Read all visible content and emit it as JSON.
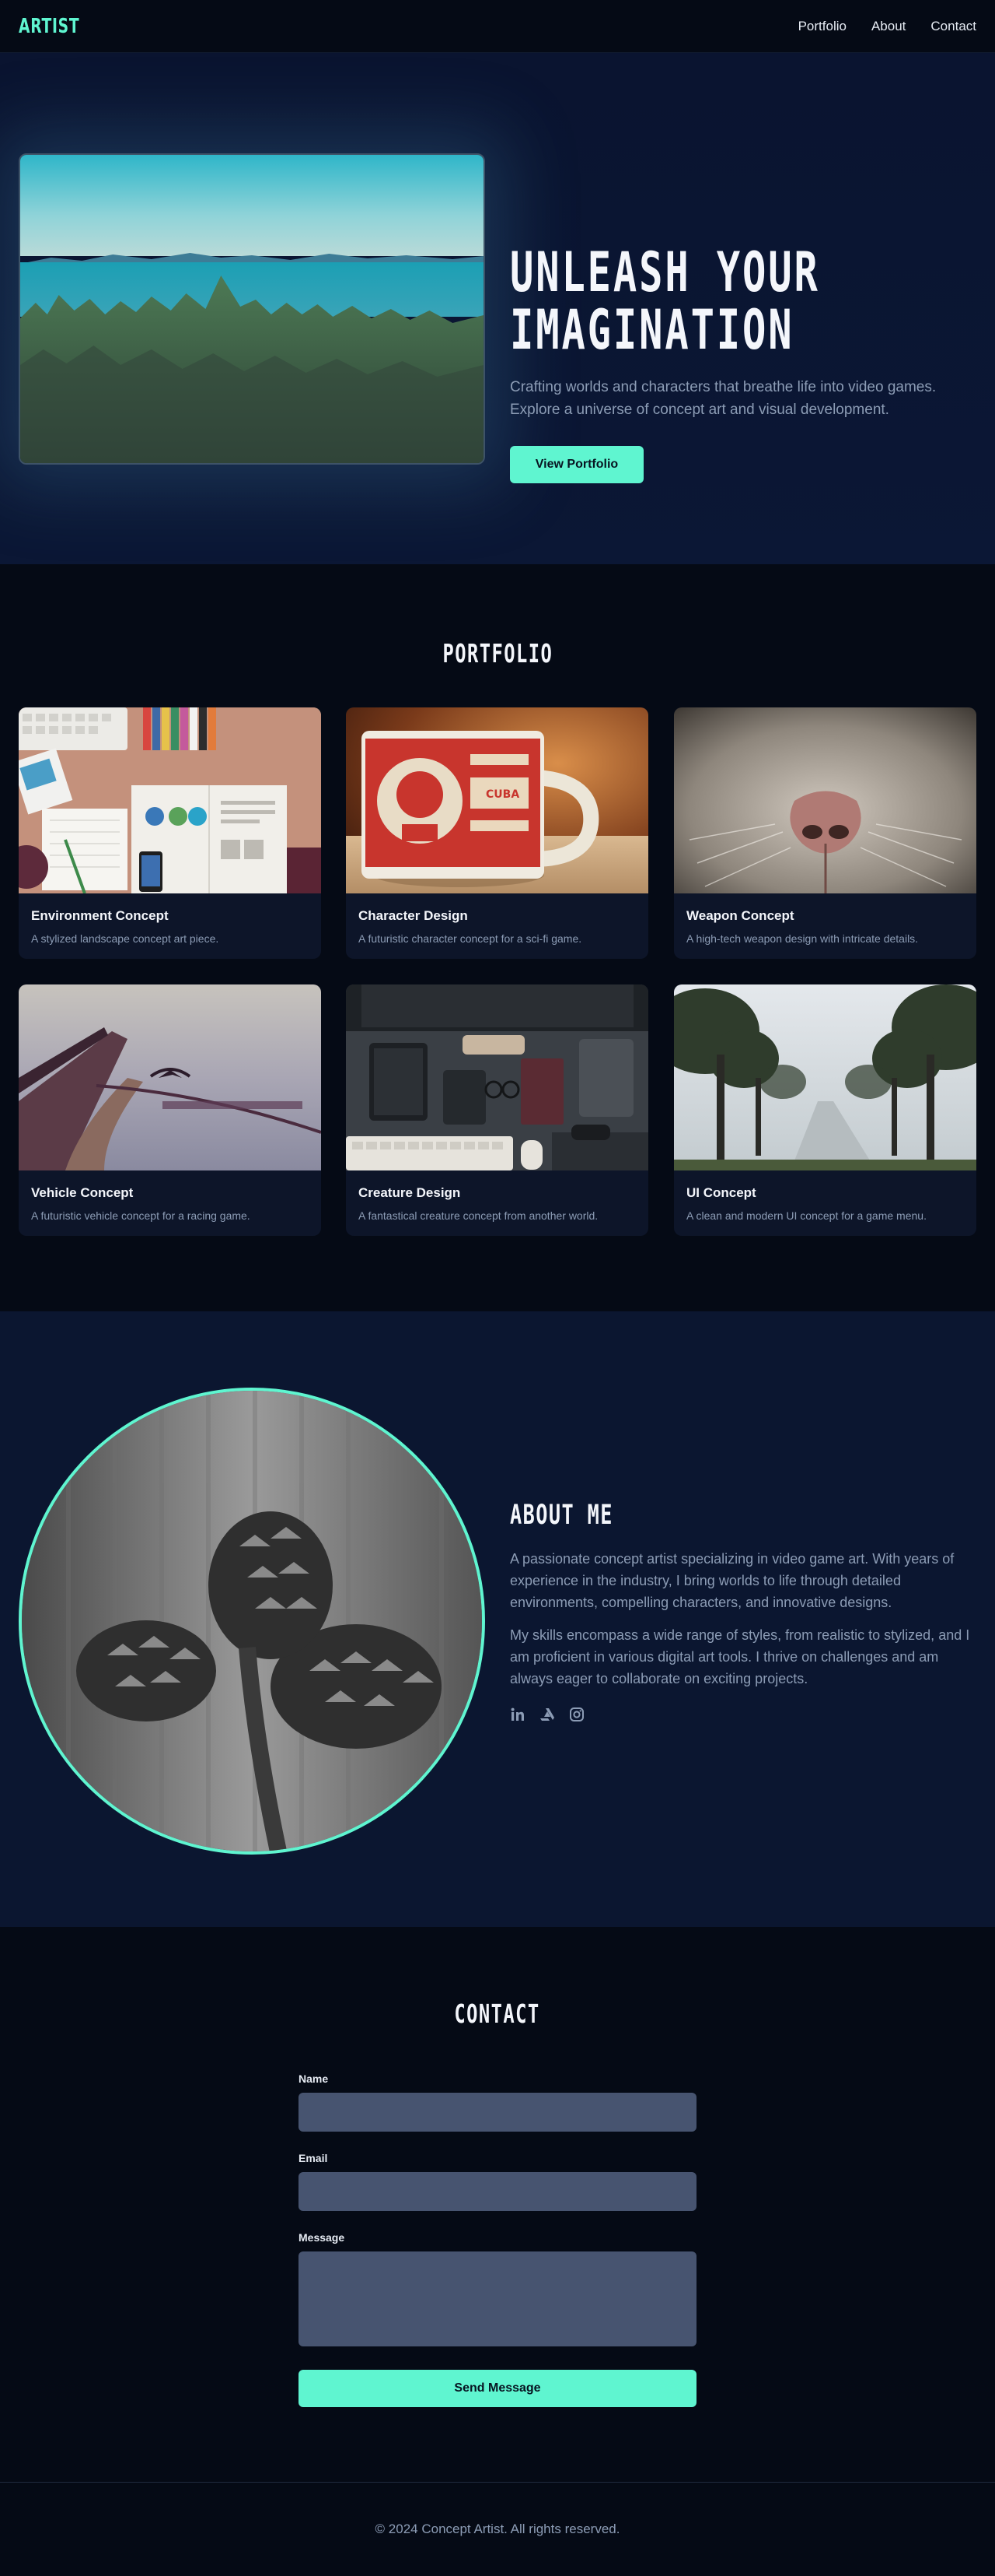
{
  "nav": {
    "logo": "ARTIST",
    "links": [
      "Portfolio",
      "About",
      "Contact"
    ]
  },
  "hero": {
    "title_line1": "UNLEASH YOUR",
    "title_line2": "IMAGINATION",
    "subtitle": "Crafting worlds and characters that breathe life into video games. Explore a universe of concept art and visual development.",
    "cta": "View Portfolio"
  },
  "portfolio": {
    "title": "PORTFOLIO",
    "items": [
      {
        "title": "Environment Concept",
        "desc": "A stylized landscape concept art piece."
      },
      {
        "title": "Character Design",
        "desc": "A futuristic character concept for a sci-fi game."
      },
      {
        "title": "Weapon Concept",
        "desc": "A high-tech weapon design with intricate details."
      },
      {
        "title": "Vehicle Concept",
        "desc": "A futuristic vehicle concept for a racing game."
      },
      {
        "title": "Creature Design",
        "desc": "A fantastical creature concept from another world."
      },
      {
        "title": "UI Concept",
        "desc": "A clean and modern UI concept for a game menu."
      }
    ]
  },
  "about": {
    "title": "ABOUT ME",
    "p1": "A passionate concept artist specializing in video game art. With years of experience in the industry, I bring worlds to life through detailed environments, compelling characters, and innovative designs.",
    "p2": "My skills encompass a wide range of styles, from realistic to stylized, and I am proficient in various digital art tools. I thrive on challenges and am always eager to collaborate on exciting projects.",
    "social_icons": [
      "linkedin-icon",
      "artstation-icon",
      "instagram-icon"
    ]
  },
  "contact": {
    "title": "CONTACT",
    "name_label": "Name",
    "email_label": "Email",
    "message_label": "Message",
    "name_value": "",
    "email_value": "",
    "message_value": "",
    "submit": "Send Message"
  },
  "footer": {
    "copyright": "© 2024 Concept Artist. All rights reserved."
  },
  "colors": {
    "accent": "#5ff5d0",
    "background": "#050a15",
    "section_alt": "#0b1630",
    "muted_text": "#8c9cb5"
  }
}
